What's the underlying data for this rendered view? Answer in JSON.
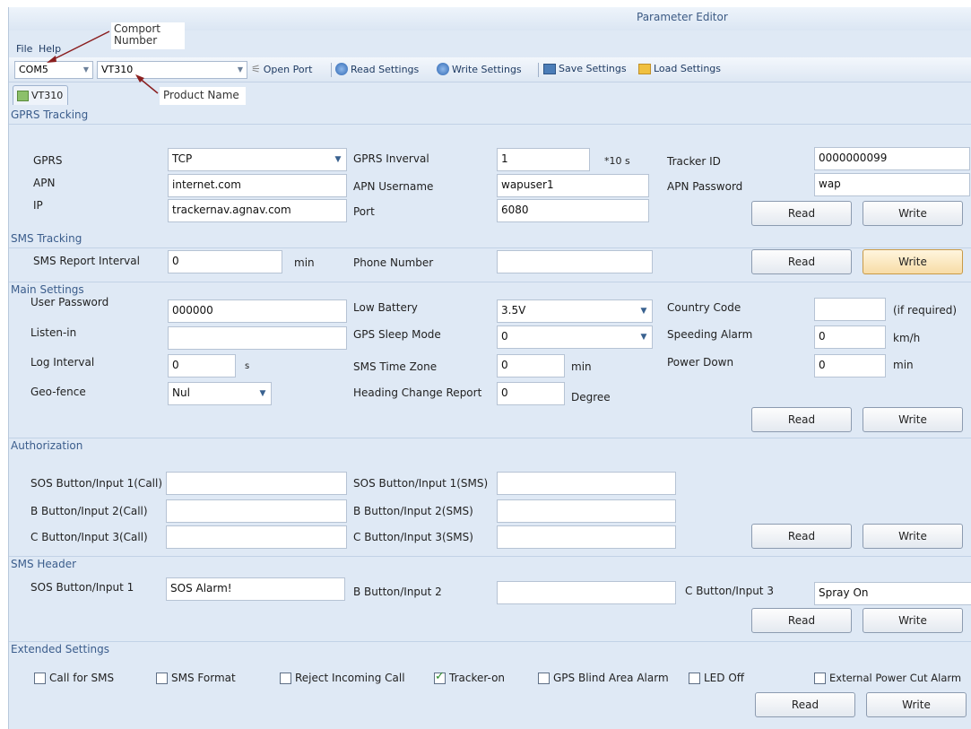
{
  "window": {
    "title": "Parameter Editor"
  },
  "menu": {
    "file": "File",
    "help": "Help"
  },
  "toolbar": {
    "port": "COM5",
    "product": "VT310",
    "open_port": "Open Port",
    "read_settings": "Read Settings",
    "write_settings": "Write Settings",
    "save_settings": "Save Settings",
    "load_settings": "Load Settings"
  },
  "annotations": {
    "comport_line1": "Comport",
    "comport_line2": "Number",
    "product_name": "Product Name"
  },
  "tab": {
    "label": "VT310"
  },
  "gprs": {
    "title": "GPRS Tracking",
    "gprs_label": "GPRS",
    "gprs_value": "TCP",
    "interval_label": "GPRS Inverval",
    "interval_value": "1",
    "interval_unit": "*10 s",
    "tracker_id_label": "Tracker ID",
    "tracker_id_value": "0000000099",
    "apn_label": "APN",
    "apn_value": "internet.com",
    "apn_user_label": "APN Username",
    "apn_user_value": "wapuser1",
    "apn_pass_label": "APN Password",
    "apn_pass_value": "wap",
    "ip_label": "IP",
    "ip_value": "trackernav.agnav.com",
    "port_label": "Port",
    "port_value": "6080",
    "read": "Read",
    "write": "Write"
  },
  "sms": {
    "title": "SMS Tracking",
    "interval_label": "SMS Report Interval",
    "interval_value": "0",
    "interval_unit": "min",
    "phone_label": "Phone Number",
    "phone_value": "",
    "read": "Read",
    "write": "Write"
  },
  "main": {
    "title": "Main Settings",
    "user_password_label": "User Password",
    "user_password_value": "000000",
    "low_battery_label": "Low Battery",
    "low_battery_value": "3.5V",
    "country_code_label": "Country Code",
    "country_code_value": "",
    "country_code_note": "(if required)",
    "listen_label": "Listen-in",
    "listen_value": "",
    "sleep_label": "GPS Sleep Mode",
    "sleep_value": "0",
    "speeding_label": "Speeding Alarm",
    "speeding_value": "0",
    "speeding_unit": "km/h",
    "log_label": "Log Interval",
    "log_value": "0",
    "log_unit": "s",
    "tz_label": "SMS Time Zone",
    "tz_value": "0",
    "tz_unit": "min",
    "power_label": "Power Down",
    "power_value": "0",
    "power_unit": "min",
    "geofence_label": "Geo-fence",
    "geofence_value": "Nul",
    "heading_label": "Heading Change Report",
    "heading_value": "0",
    "heading_unit": "Degree",
    "read": "Read",
    "write": "Write"
  },
  "auth": {
    "title": "Authorization",
    "sos_call_label": "SOS Button/Input 1(Call)",
    "sos_sms_label": "SOS Button/Input 1(SMS)",
    "b_call_label": "B Button/Input 2(Call)",
    "b_sms_label": "B Button/Input 2(SMS)",
    "c_call_label": "C Button/Input 3(Call)",
    "c_sms_label": "C Button/Input 3(SMS)",
    "read": "Read",
    "write": "Write"
  },
  "header": {
    "title": "SMS Header",
    "sos_label": "SOS Button/Input 1",
    "sos_value": "SOS Alarm!",
    "b_label": "B Button/Input 2",
    "b_value": "",
    "c_label": "C Button/Input 3",
    "c_value": "Spray On",
    "read": "Read",
    "write": "Write"
  },
  "extended": {
    "title": "Extended Settings",
    "call_for_sms": "Call for SMS",
    "sms_format": "SMS Format",
    "reject_call": "Reject Incoming Call",
    "tracker_on": "Tracker-on",
    "blind_area": "GPS Blind Area Alarm",
    "led_off": "LED Off",
    "power_cut": "External Power Cut Alarm",
    "read": "Read",
    "write": "Write"
  }
}
